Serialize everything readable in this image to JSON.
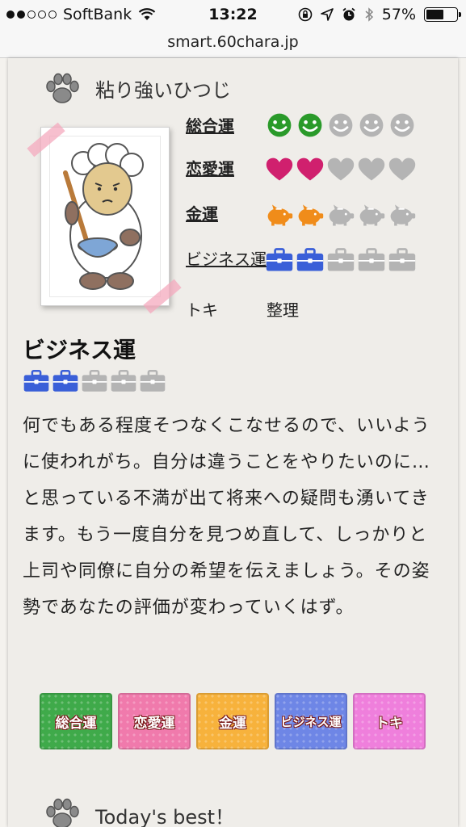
{
  "status": {
    "carrier": "SoftBank",
    "time": "13:22",
    "battery": "57%",
    "battery_level": 0.57,
    "signal_bars": 2
  },
  "browser": {
    "url": "smart.60chara.jp"
  },
  "character": {
    "name": "粘り強いひつじ"
  },
  "fortunes": [
    {
      "label": "総合運",
      "score": 2,
      "max": 5,
      "color": "#2a9a2a",
      "icon": "smiley-icon"
    },
    {
      "label": "恋愛運",
      "score": 2,
      "max": 5,
      "color": "#d0206e",
      "icon": "heart-icon"
    },
    {
      "label": "金運",
      "score": 2,
      "max": 5,
      "color": "#f08c1a",
      "icon": "piggy-bank-icon"
    },
    {
      "label": "ビジネス運",
      "score": 2,
      "max": 5,
      "color": "#3a5fd8",
      "icon": "briefcase-icon"
    }
  ],
  "extra": {
    "toki_label": "トキ",
    "toki_value": "整理"
  },
  "detail": {
    "title": "ビジネス運",
    "score": 2,
    "max": 5,
    "text": "何でもある程度そつなくこなせるので、いいように使われがち。自分は違うことをやりたいのに…と思っている不満が出て将来への疑問も湧いてきます。もう一度自分を見つめ直して、しっかりと上司や同僚に自分の希望を伝えましょう。その姿勢であなたの評価が変わっていくはず。"
  },
  "buttons": [
    {
      "label": "総合運",
      "color": "#3faa4a"
    },
    {
      "label": "恋愛運",
      "color": "#f07aac"
    },
    {
      "label": "金運",
      "color": "#f7b23c"
    },
    {
      "label": "ビジネス運",
      "color": "#6e86e6"
    },
    {
      "label": "トキ",
      "color": "#ef7fdc"
    }
  ],
  "next_section": {
    "title": "Today's best！"
  },
  "colors": {
    "inactive": "#b4b4b4"
  }
}
